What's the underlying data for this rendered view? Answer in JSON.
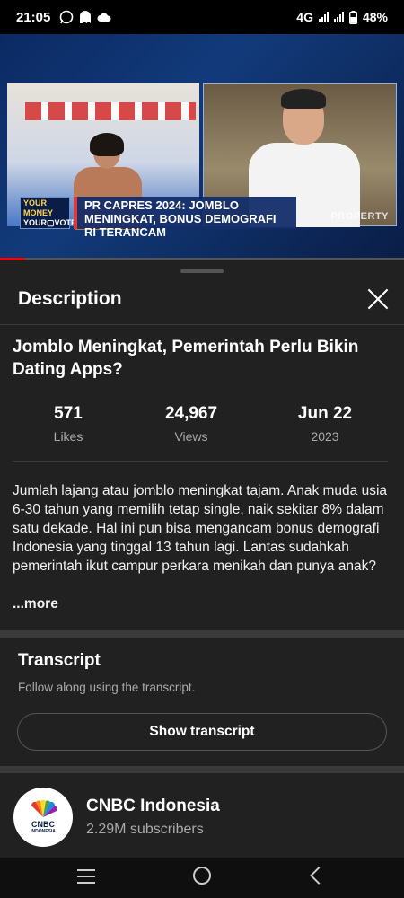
{
  "status_bar": {
    "time": "21:05",
    "network": "4G",
    "battery": "48%",
    "icons": [
      "whatsapp-icon",
      "ghost-icon",
      "cloud-icon",
      "signal-icon",
      "signal-icon",
      "battery-icon"
    ]
  },
  "video": {
    "lower_third": "PR CAPRES 2024: JOMBLO MENINGKAT, BONUS DEMOGRAFI RI TERANCAM",
    "logo_line1": "YOUR MONEY",
    "logo_line2": "YOUR▢VOTE",
    "watermark": "PROPERTY",
    "progress": 0.062
  },
  "sheet": {
    "title": "Description",
    "close_icon": "close-icon"
  },
  "video_info": {
    "title": "Jomblo Meningkat, Pemerintah Perlu Bikin Dating Apps?",
    "likes_value": "571",
    "likes_label": "Likes",
    "views_value": "24,967",
    "views_label": "Views",
    "date_value": "Jun 22",
    "date_label": "2023",
    "description": "Jumlah lajang atau jomblo meningkat tajam. Anak muda usia 6-30 tahun yang memilih tetap single, naik sekitar 8% dalam satu dekade. Hal ini pun bisa mengancam bonus demografi Indonesia yang tinggal 13 tahun lagi. Lantas sudahkah pemerintah ikut campur perkara menikah dan punya anak?",
    "more_label": "...more"
  },
  "transcript": {
    "title": "Transcript",
    "subtitle": "Follow along using the transcript.",
    "button_label": "Show transcript"
  },
  "channel": {
    "name": "CNBC Indonesia",
    "subscribers": "2.29M subscribers",
    "avatar_text": "CNBC",
    "avatar_subtext": "INDONESIA"
  },
  "nav": {
    "icons": [
      "recents-icon",
      "home-icon",
      "back-icon"
    ]
  }
}
